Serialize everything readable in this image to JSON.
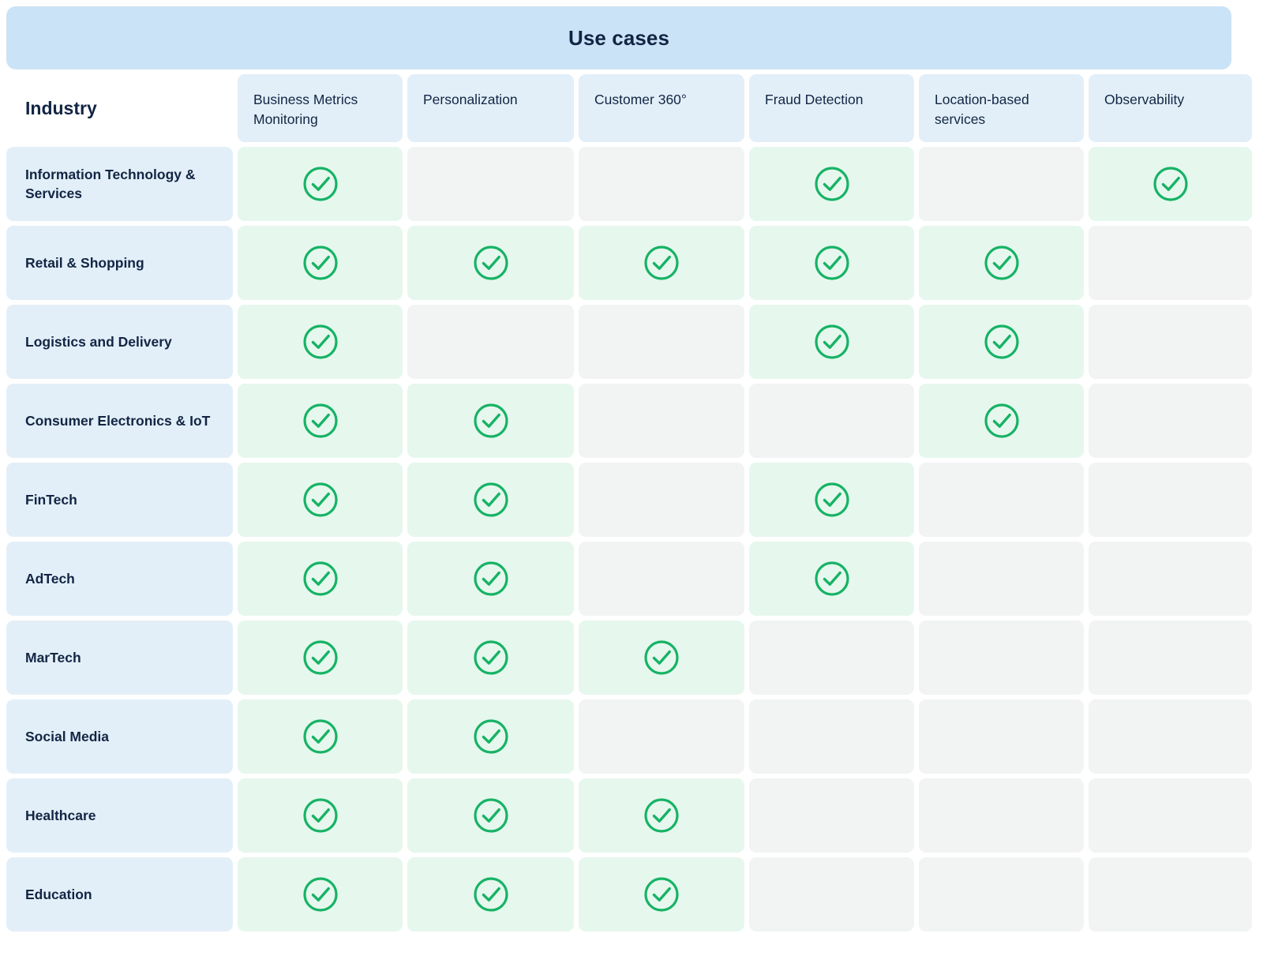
{
  "banner": {
    "title": "Use cases"
  },
  "colors": {
    "banner_bg": "#cbe3f6",
    "header_cell_bg": "#e3eff8",
    "row_label_bg": "#e3eff8",
    "cell_on_bg": "#e6f7ee",
    "cell_off_bg": "#f2f3f3",
    "text": "#122544",
    "check_green": "#16b364"
  },
  "table": {
    "corner_label": "Industry",
    "columns": [
      {
        "label": "Business Metrics Monitoring"
      },
      {
        "label": "Personalization"
      },
      {
        "label": "Customer 360°"
      },
      {
        "label": "Fraud Detection"
      },
      {
        "label": "Location-based services"
      },
      {
        "label": "Observability"
      }
    ],
    "rows": [
      {
        "label": "Information Technology & Services",
        "cells": [
          true,
          false,
          false,
          true,
          false,
          true
        ]
      },
      {
        "label": "Retail & Shopping",
        "cells": [
          true,
          true,
          true,
          true,
          true,
          false
        ]
      },
      {
        "label": "Logistics and Delivery",
        "cells": [
          true,
          false,
          false,
          true,
          true,
          false
        ]
      },
      {
        "label": "Consumer Electronics & IoT",
        "cells": [
          true,
          true,
          false,
          false,
          true,
          false
        ]
      },
      {
        "label": "FinTech",
        "cells": [
          true,
          true,
          false,
          true,
          false,
          false
        ]
      },
      {
        "label": "AdTech",
        "cells": [
          true,
          true,
          false,
          true,
          false,
          false
        ]
      },
      {
        "label": "MarTech",
        "cells": [
          true,
          true,
          true,
          false,
          false,
          false
        ]
      },
      {
        "label": "Social Media",
        "cells": [
          true,
          true,
          false,
          false,
          false,
          false
        ]
      },
      {
        "label": "Healthcare",
        "cells": [
          true,
          true,
          true,
          false,
          false,
          false
        ]
      },
      {
        "label": "Education",
        "cells": [
          true,
          true,
          true,
          false,
          false,
          false
        ]
      }
    ]
  },
  "icons": {
    "check": "check-circle-icon"
  }
}
